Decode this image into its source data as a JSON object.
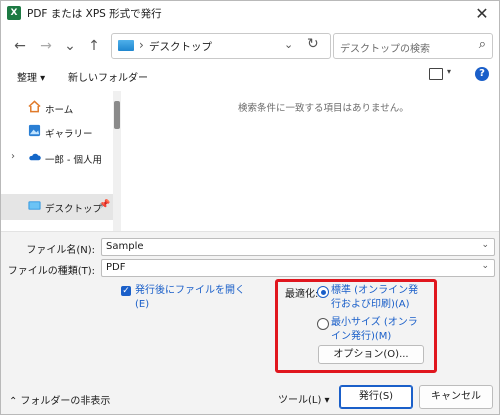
{
  "window": {
    "title": "PDF または XPS 形式で発行",
    "app_icon_letter": "X",
    "close_glyph": "✕"
  },
  "nav": {
    "back_glyph": "←",
    "forward_glyph": "→",
    "recent_glyph": "⌄",
    "up_glyph": "↑",
    "address_sep": "›",
    "address": "デスクトップ",
    "address_dropdown": "⌄",
    "refresh_glyph": "↻",
    "search_placeholder": "デスクトップの検索",
    "search_glyph": "⌕"
  },
  "toolbar": {
    "organize": "整理 ▾",
    "new_folder": "新しいフォルダー",
    "view_dropdown": "▾",
    "help": "?"
  },
  "sidebar": {
    "items": [
      {
        "label": "ホーム",
        "icon": "home-icon"
      },
      {
        "label": "ギャラリー",
        "icon": "gallery-icon"
      },
      {
        "label": "一郎 - 個人用",
        "icon": "cloud-icon",
        "chevron": "›"
      },
      {
        "label": "デスクトップ",
        "icon": "desktop-folder-icon",
        "pin": "📌"
      }
    ]
  },
  "file_pane": {
    "empty_message": "検索条件に一致する項目はありません。"
  },
  "form": {
    "filename_label": "ファイル名(N):",
    "filename_value": "Sample",
    "filetype_label": "ファイルの種類(T):",
    "filetype_value": "PDF",
    "dropdown_glyph": "⌄",
    "open_after_publish": "発行後にファイルを開く(E)",
    "open_after_publish_checked": true,
    "optimize_label": "最適化:",
    "optimize_standard": "標準 (オンライン発行および印刷)(A)",
    "optimize_minimum": "最小サイズ (オンライン発行)(M)",
    "options_button": "オプション(O)..."
  },
  "footer": {
    "hide_folders": "フォルダーの非表示",
    "hide_folders_chevron": "⌃",
    "tools": "ツール(L) ▾",
    "publish": "発行(S)",
    "cancel": "キャンセル"
  },
  "colors": {
    "accent": "#1a5fc9",
    "highlight_border": "#e0161e",
    "app_icon": "#1d7a43"
  }
}
